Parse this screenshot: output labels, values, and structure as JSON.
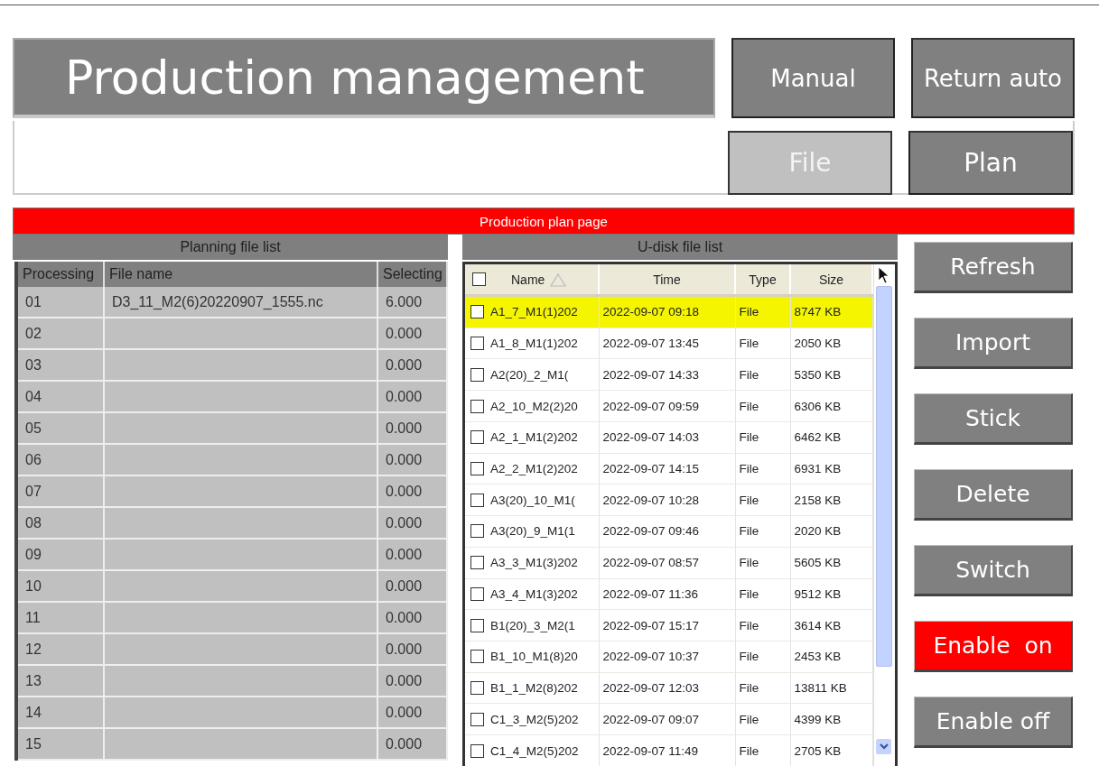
{
  "header": {
    "title": "Production management",
    "buttons": [
      {
        "label": "Manual"
      },
      {
        "label": "Return auto"
      }
    ]
  },
  "tabs": [
    {
      "label": "File",
      "selected": true
    },
    {
      "label": "Plan",
      "selected": false
    }
  ],
  "page_banner": "Production plan page",
  "planning_list": {
    "title": "Planning file list",
    "columns": [
      "Processing",
      "File name",
      "Selecting"
    ],
    "rows": [
      [
        "01",
        "D3_11_M2(6)20220907_1555.nc",
        "6.000"
      ],
      [
        "02",
        "",
        "0.000"
      ],
      [
        "03",
        "",
        "0.000"
      ],
      [
        "04",
        "",
        "0.000"
      ],
      [
        "05",
        "",
        "0.000"
      ],
      [
        "06",
        "",
        "0.000"
      ],
      [
        "07",
        "",
        "0.000"
      ],
      [
        "08",
        "",
        "0.000"
      ],
      [
        "09",
        "",
        "0.000"
      ],
      [
        "10",
        "",
        "0.000"
      ],
      [
        "11",
        "",
        "0.000"
      ],
      [
        "12",
        "",
        "0.000"
      ],
      [
        "13",
        "",
        "0.000"
      ],
      [
        "14",
        "",
        "0.000"
      ],
      [
        "15",
        "",
        "0.000"
      ]
    ]
  },
  "udisk_list": {
    "title": "U-disk file list",
    "all_checked": false,
    "columns": [
      "Name",
      "Time",
      "Type",
      "Size"
    ],
    "rows": [
      {
        "name": "A1_7_M1(1)202",
        "time": "2022-09-07 09:18",
        "type": "File",
        "size": "8747 KB",
        "checked": false,
        "selected": true
      },
      {
        "name": "A1_8_M1(1)202",
        "time": "2022-09-07 13:45",
        "type": "File",
        "size": "2050 KB",
        "checked": false,
        "selected": false
      },
      {
        "name": "A2(20)_2_M1(",
        "time": "2022-09-07 14:33",
        "type": "File",
        "size": "5350 KB",
        "checked": false,
        "selected": false
      },
      {
        "name": "A2_10_M2(2)20",
        "time": "2022-09-07 09:59",
        "type": "File",
        "size": "6306 KB",
        "checked": false,
        "selected": false
      },
      {
        "name": "A2_1_M1(2)202",
        "time": "2022-09-07 14:03",
        "type": "File",
        "size": "6462 KB",
        "checked": false,
        "selected": false
      },
      {
        "name": "A2_2_M1(2)202",
        "time": "2022-09-07 14:15",
        "type": "File",
        "size": "6931 KB",
        "checked": false,
        "selected": false
      },
      {
        "name": "A3(20)_10_M1(",
        "time": "2022-09-07 10:28",
        "type": "File",
        "size": "2158 KB",
        "checked": false,
        "selected": false
      },
      {
        "name": "A3(20)_9_M1(1",
        "time": "2022-09-07 09:46",
        "type": "File",
        "size": "2020 KB",
        "checked": false,
        "selected": false
      },
      {
        "name": "A3_3_M1(3)202",
        "time": "2022-09-07 08:57",
        "type": "File",
        "size": "5605 KB",
        "checked": false,
        "selected": false
      },
      {
        "name": "A3_4_M1(3)202",
        "time": "2022-09-07 11:36",
        "type": "File",
        "size": "9512 KB",
        "checked": false,
        "selected": false
      },
      {
        "name": "B1(20)_3_M2(1",
        "time": "2022-09-07 15:17",
        "type": "File",
        "size": "3614 KB",
        "checked": false,
        "selected": false
      },
      {
        "name": "B1_10_M1(8)20",
        "time": "2022-09-07 10:37",
        "type": "File",
        "size": "2453 KB",
        "checked": false,
        "selected": false
      },
      {
        "name": "B1_1_M2(8)202",
        "time": "2022-09-07 12:03",
        "type": "File",
        "size": "13811 KB",
        "checked": false,
        "selected": false
      },
      {
        "name": "C1_3_M2(5)202",
        "time": "2022-09-07 09:07",
        "type": "File",
        "size": "4399 KB",
        "checked": false,
        "selected": false
      },
      {
        "name": "C1_4_M2(5)202",
        "time": "2022-09-07 11:49",
        "type": "File",
        "size": "2705 KB",
        "checked": false,
        "selected": false
      }
    ]
  },
  "side_buttons": [
    {
      "label": "Refresh",
      "active": false
    },
    {
      "label": "Import",
      "active": false
    },
    {
      "label": "Stick",
      "active": false
    },
    {
      "label": "Delete",
      "active": false
    },
    {
      "label": "Switch",
      "active": false
    },
    {
      "label": "Enable  on",
      "active": true
    },
    {
      "label": "Enable off",
      "active": false
    }
  ]
}
